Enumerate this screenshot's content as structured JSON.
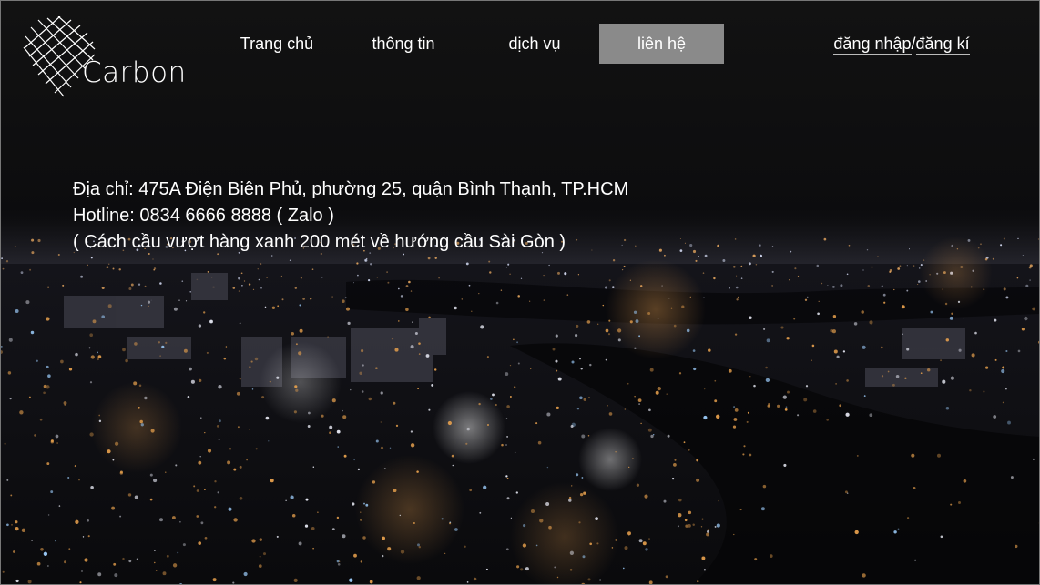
{
  "brand": {
    "logo_icon": "crosshatch-diamond-icon",
    "name": "Carbon"
  },
  "nav": {
    "items": [
      {
        "label": "Trang chủ"
      },
      {
        "label": "thông tin"
      },
      {
        "label": "dịch vụ"
      },
      {
        "label": "liên hệ",
        "active": true
      }
    ],
    "active_color": "#8a8a8a"
  },
  "auth": {
    "login_label": "đăng nhập",
    "separator": "/",
    "register_label": "đăng kí"
  },
  "contact": {
    "address": "Địa chỉ: 475A Điện Biên Phủ, phường 25, quận Bình Thạnh, TP.HCM",
    "hotline": "Hotline: 0834 6666 8888 ( Zalo )",
    "note": "( Cách cầu vượt hàng xanh 200 mét về hướng cầu Sài Gòn )"
  },
  "background": {
    "description_icon": "night-city-aerial-image",
    "base_color": "#0b0b0d",
    "light_color": "#e0a050"
  }
}
